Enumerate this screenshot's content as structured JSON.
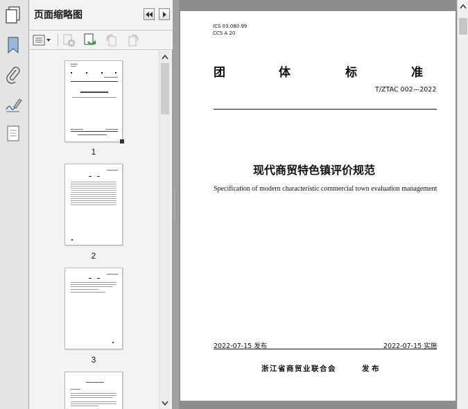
{
  "panel": {
    "title": "页面缩略图",
    "page_labels": [
      "1",
      "2",
      "3"
    ]
  },
  "document": {
    "ics": "ICS 03.080.99",
    "ccs": "CCS A 20",
    "category": [
      "团",
      "体",
      "标",
      "准"
    ],
    "standard_no": "T/ZTAC 002—2022",
    "title_cn": "现代商贸特色镇评价规范",
    "title_en": "Specification of modern characteristic commercial town evaluation management",
    "publish_date": "2022-07-15 发布",
    "implement_date": "2022-07-15 实施",
    "publisher": "浙江省商贸业联合会",
    "publish_word": "发 布"
  },
  "icons": {
    "leftbar": [
      "pages-icon",
      "bookmark-icon",
      "paperclip-icon",
      "signature-icon",
      "layers-icon"
    ],
    "toolbar": [
      "options-menu-icon",
      "delete-page-icon",
      "insert-page-icon",
      "rotate-left-icon",
      "rotate-right-icon"
    ],
    "nav": [
      "collapse-panel-icon",
      "expand-panel-icon"
    ]
  },
  "colors": {
    "accent": "#3c6fbf",
    "panel_bg": "#f3f3f3",
    "viewer_bg": "#8d8d8d"
  }
}
